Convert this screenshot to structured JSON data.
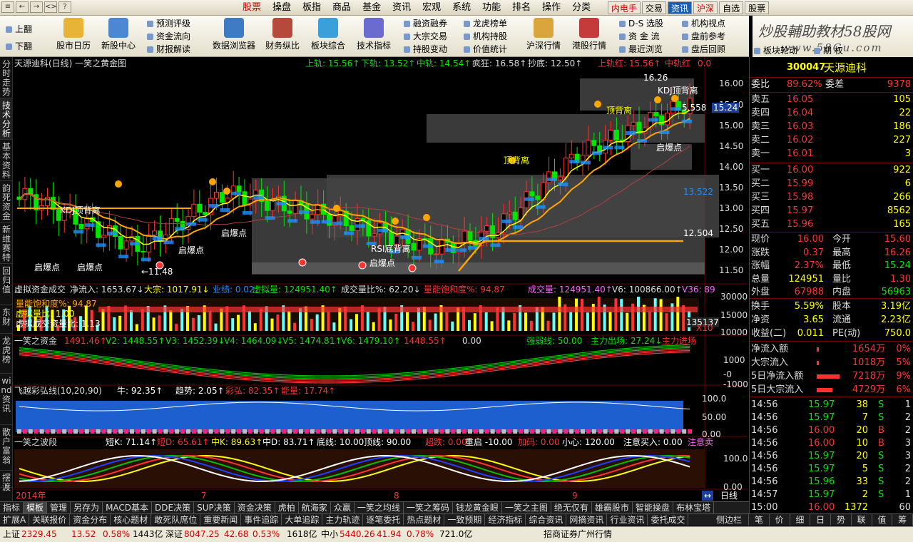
{
  "menubar": {
    "win_buttons": [
      "≡",
      "←",
      "→",
      "<>",
      "?"
    ],
    "menus": [
      "股票",
      "操盘",
      "板指",
      "商品",
      "基金",
      "资讯",
      "宏观",
      "系统",
      "功能",
      "排名",
      "操作",
      "分类"
    ],
    "quote_tabs": [
      "内电手",
      "交易",
      "资讯",
      "沪深",
      "自选",
      "股票"
    ]
  },
  "toolbar": {
    "flip": [
      "上翻",
      "下翻"
    ],
    "big": [
      "股市日历",
      "新股中心",
      "数据浏览器",
      "财务纵比",
      "板块综合",
      "技术指标",
      "沪深行情",
      "港股行情"
    ],
    "small": [
      [
        "预测评级",
        "资金流向",
        "财报解读"
      ],
      [
        "融资融券",
        "大宗交易",
        "持股变动"
      ],
      [
        "龙虎榜单",
        "机构持股",
        "价值统计"
      ],
      [
        "D-S 选股",
        "资 金 流",
        "最近浏览"
      ],
      [
        "机构视点",
        "盘前参考",
        "盘后回顾"
      ]
    ],
    "tail": [
      "板块轮动",
      "期 权"
    ]
  },
  "logo": {
    "title": "炒股輔助教材58股网",
    "url": "www.58Gu.com"
  },
  "left_tabs": [
    "分时走势",
    "技术分析",
    "基本资料",
    "韵死资金",
    "新维赛特",
    "回归值",
    "东财",
    "龙虎榜",
    "wind资讯",
    "散户富翁",
    "摆渡"
  ],
  "main_chart": {
    "title": "天源迪科(日线) 一笑之黄金图",
    "top_labels": [
      "上轨: 15.56↑",
      "下轨: 13.52↑",
      "中轨: 14.54↑",
      "疯狂: 16.58↑",
      "抄底: 12.50↑",
      "上轨红: 15.56↑",
      "中轨红",
      "0.0"
    ],
    "annotations": {
      "kdj1": "KDJ顶背离",
      "kdj2": "KDJ顶背离",
      "qiang1": "顶背离",
      "qiang2": "顶背离",
      "rsi": "RSI底背离",
      "bao": [
        "启爆点",
        "启爆点",
        "启爆点",
        "启爆点",
        "启爆点",
        "启爆点"
      ],
      "low": "←11.48",
      "high": "16.26"
    },
    "price_axis": [
      "16.00",
      "15.50",
      "15.00",
      "14.50",
      "14.00",
      "13.50",
      "13.00",
      "12.50",
      "12.00",
      "11.50"
    ],
    "tags": {
      "p1": "5.558",
      "p2": "15.24",
      "p3": "13.522",
      "p4": "12.504"
    }
  },
  "vol_panel": {
    "labels": [
      "虚拟资金成交",
      "净流入: 1653.67↓",
      "大宗: 1017.91↓",
      "业绩: 0.02",
      "虚拟量: 124951.40↑",
      "成交量比%: 62.20↓",
      "量能饱和度%: 94.87",
      "成交量: 124951.40↑",
      "V6: 100866.00↑",
      "V36: 89"
    ],
    "sub": [
      "量能饱和度%: 94.87",
      "虚拟量比: 1.00",
      "虚拟成交资量比: 1.13"
    ],
    "axis": [
      "30000",
      "15000",
      "10000"
    ],
    "tag": "135137",
    "x10": "X10"
  },
  "cap_panel": {
    "labels": [
      "一笑之资金",
      "1491.46↑",
      "V2: 1448.55↑",
      "V3: 1452.39↓",
      "V4: 1464.09↓",
      "V5: 1474.81↑",
      "V6: 1479.10↑",
      "1448.55↑",
      "0.00",
      "强弱线: 50.00",
      "主力出场: 27.24↓",
      "主力进场"
    ],
    "axis": [
      "1000",
      "-0",
      "-1000"
    ]
  },
  "rainbow": {
    "labels": [
      "飞越彩弘线(10,20,90)",
      "牛: 92.35↑",
      "趋势: 2.05↑",
      "彩弘: 82.35↑",
      "能量: 17.74↑"
    ],
    "axis": [
      "100.0",
      "50.00",
      "0.00"
    ]
  },
  "wave": {
    "labels": [
      "一笑之波段",
      "短K: 71.14↑",
      "短D: 65.61↑",
      "中K: 89.63↑",
      "中D: 83.71↑",
      "底线: 10.00",
      "顶线: 90.00",
      "超跌: 0.00",
      "重启 -10.00",
      "加码: 0.00",
      "小心: 120.00",
      "注意买入: 0.00",
      "注意卖"
    ],
    "axis": [
      "100.0",
      "0.00"
    ]
  },
  "date_axis": [
    "2014年",
    "7",
    "8",
    "9"
  ],
  "period": "日线",
  "stock": {
    "code": "300047",
    "name": "天源迪科"
  },
  "order_book": {
    "weibi": {
      "label": "委比",
      "value": "89.62%",
      "label2": "委差",
      "value2": "9378"
    },
    "asks": [
      [
        "卖五",
        "16.05",
        "105"
      ],
      [
        "卖四",
        "16.04",
        "22"
      ],
      [
        "卖三",
        "16.03",
        "186"
      ],
      [
        "卖二",
        "16.02",
        "227"
      ],
      [
        "卖一",
        "16.01",
        "3"
      ]
    ],
    "bids": [
      [
        "买一",
        "16.00",
        "922"
      ],
      [
        "买二",
        "15.99",
        "6"
      ],
      [
        "买三",
        "15.98",
        "266"
      ],
      [
        "买四",
        "15.97",
        "8562"
      ],
      [
        "买五",
        "15.96",
        "165"
      ]
    ]
  },
  "quote": [
    [
      "现价",
      "16.00",
      "今开",
      "15.60"
    ],
    [
      "涨跌",
      "0.37",
      "最高",
      "16.26"
    ],
    [
      "涨幅",
      "2.37%",
      "最低",
      "15.24"
    ],
    [
      "总量",
      "124951",
      "量比",
      "1.30"
    ],
    [
      "外盘",
      "67988",
      "内盘",
      "56963"
    ]
  ],
  "stats": [
    [
      "换手",
      "5.59%",
      "股本",
      "3.19亿"
    ],
    [
      "净资",
      "3.65",
      "流通",
      "2.23亿"
    ],
    [
      "收益(二)",
      "0.011",
      "PE(动)",
      "750.0"
    ]
  ],
  "flows": [
    [
      "净流入额",
      "1654万",
      "0%"
    ],
    [
      "大宗流入",
      "1018万",
      "5%"
    ],
    [
      "5日净流入额",
      "7218万",
      "9%"
    ],
    [
      "5日大宗流入",
      "4729万",
      "6%"
    ]
  ],
  "ticks": [
    [
      "14:56",
      "15.97",
      "38",
      "S",
      "1"
    ],
    [
      "14:56",
      "15.97",
      "7",
      "S",
      "2"
    ],
    [
      "14:56",
      "16.00",
      "20",
      "B",
      "2"
    ],
    [
      "14:56",
      "16.00",
      "10",
      "B",
      "3"
    ],
    [
      "14:56",
      "15.97",
      "20",
      "S",
      "3"
    ],
    [
      "14:56",
      "15.97",
      "5",
      "S",
      "2"
    ],
    [
      "14:56",
      "15.96",
      "33",
      "S",
      "2"
    ],
    [
      "14:57",
      "15.97",
      "2",
      "S",
      "1"
    ],
    [
      "15:00",
      "16.00",
      "1372",
      "",
      "60"
    ]
  ],
  "bottom_tabs1": [
    "指标",
    "模板",
    "管理",
    "另存为",
    "MACD基本",
    "DDE决策",
    "SUP决策",
    "资金决策",
    "虎柏",
    "航海家",
    "众赢",
    "一笑之均线",
    "一笑之筹码",
    "钱龙黄金眼",
    "一笑之主图",
    "绝无仅有",
    "雄霸股市",
    "智能操盘",
    "布林宝塔"
  ],
  "bottom_tabs2": [
    "扩展A",
    "关联报价",
    "资金分布",
    "核心题材",
    "敢死队席位",
    "重要新闻",
    "事件追踪",
    "大单追踪",
    "主力轨迹",
    "逐笔委托",
    "热点题材",
    "一致预期",
    "经济指标",
    "综合资讯",
    "网摘资讯",
    "行业资讯",
    "委托成交"
  ],
  "sidebar_btn": "侧边栏",
  "right_tabs": [
    "笔",
    "价",
    "细",
    "日",
    "势",
    "联",
    "值",
    "筹"
  ],
  "status": {
    "sh_name": "上证",
    "sh_idx": "2329.45",
    "sh_chg": "13.52",
    "sh_pct": "0.58%",
    "sh_amt": "1443亿",
    "sz_name": "深证",
    "sz_idx": "8047.25",
    "sz_chg": "42.68",
    "sz_pct": "0.53%",
    "sz_amt": "1618亿",
    "zx_name": "中小",
    "zx_idx": "5440.26",
    "zx_chg": "41.94",
    "zx_pct": "0.78%",
    "zx_amt": "721.0亿",
    "broker": "招商证券广州行情"
  },
  "colors": {
    "up": "#ff3232",
    "down": "#00e600",
    "yellow": "#ffff00",
    "orange": "#ffa500",
    "blue": "#1e90ff",
    "grey": "#444444"
  }
}
